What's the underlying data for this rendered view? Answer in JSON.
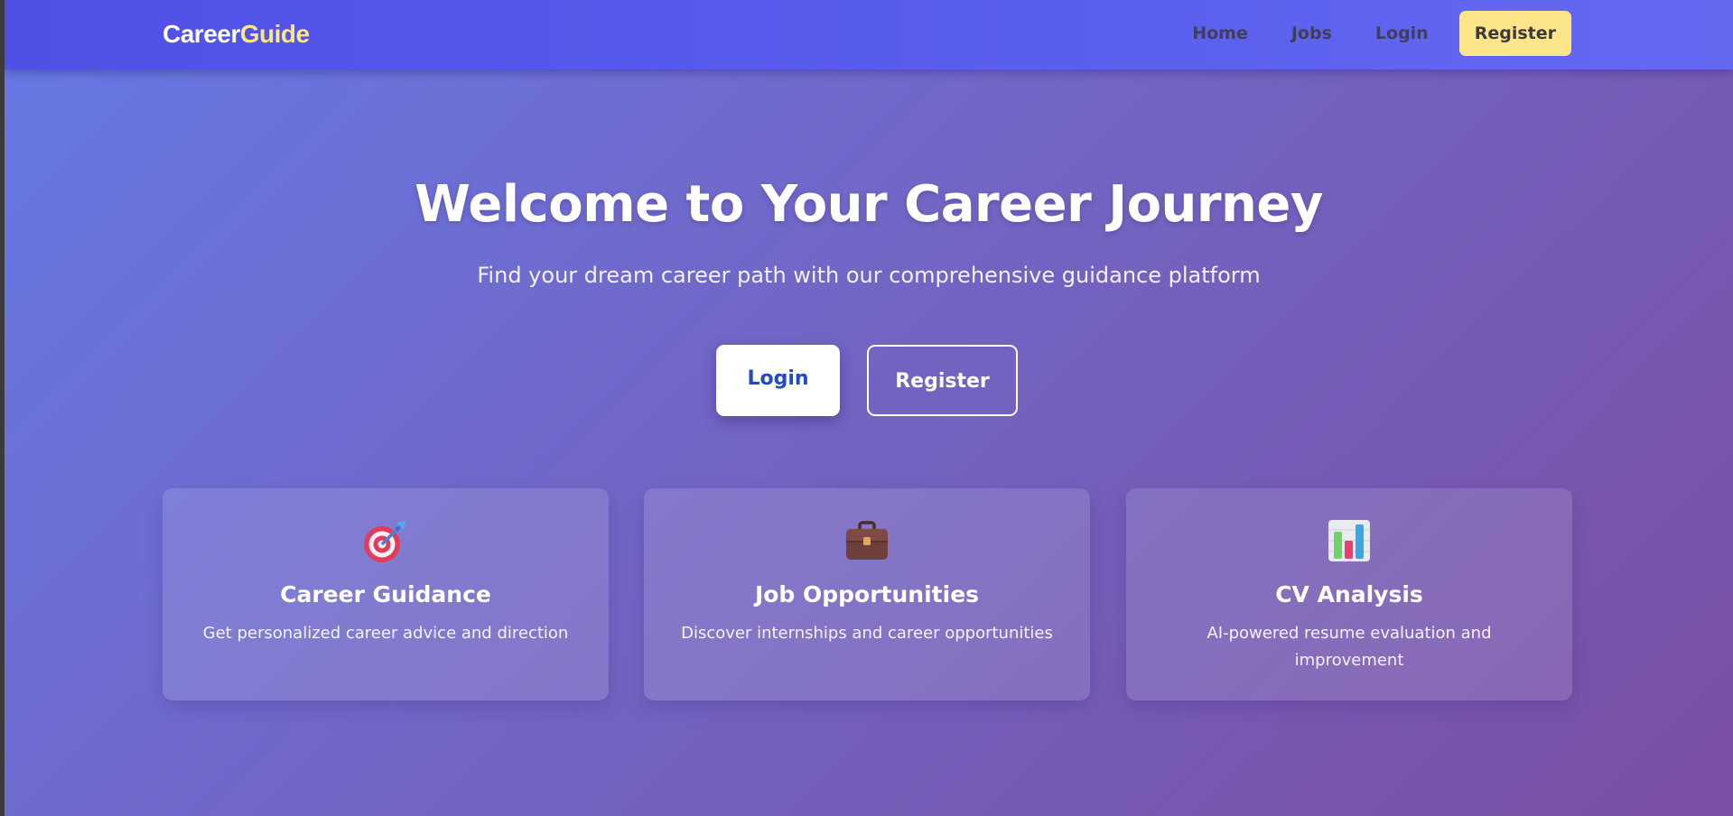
{
  "navbar": {
    "brand_part1": "Career",
    "brand_part2": "Guide",
    "links": [
      "Home",
      "Jobs",
      "Login"
    ],
    "register_label": "Register"
  },
  "hero": {
    "title": "Welcome to Your Career Journey",
    "subtitle": "Find your dream career path with our comprehensive guidance platform",
    "login_label": "Login",
    "register_label": "Register"
  },
  "features": [
    {
      "icon": "target-icon",
      "title": "Career Guidance",
      "description": "Get personalized career advice and direction"
    },
    {
      "icon": "briefcase-icon",
      "title": "Job Opportunities",
      "description": "Discover internships and career opportunities"
    },
    {
      "icon": "bar-chart-icon",
      "title": "CV Analysis",
      "description": "AI-powered resume evaluation and improvement"
    }
  ],
  "colors": {
    "brand_accent": "#fde68a",
    "navbar": "#5050e6",
    "primary_text": "#2348c8"
  }
}
